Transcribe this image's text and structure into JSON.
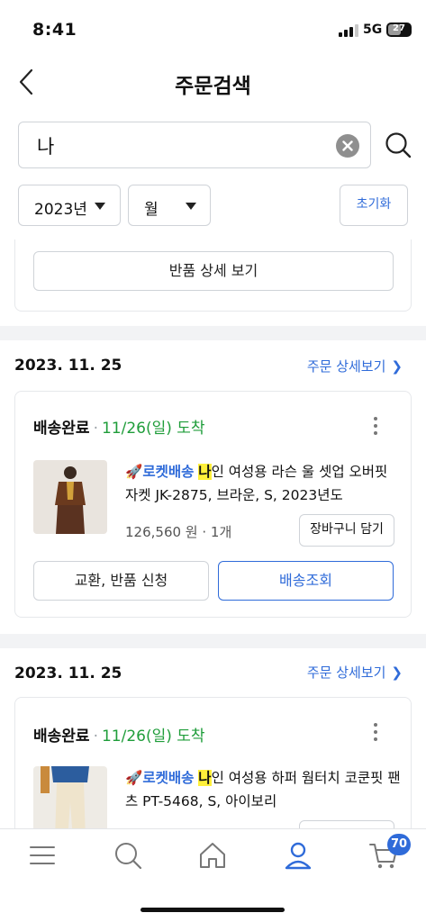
{
  "status_bar": {
    "time": "8:41",
    "network": "5G",
    "battery": "27"
  },
  "header": {
    "title": "주문검색"
  },
  "search": {
    "query": "나"
  },
  "filters": {
    "year": "2023년",
    "month": "월",
    "reset_label": "초기화"
  },
  "partial_order": {
    "return_detail_label": "반품 상세 보기"
  },
  "orders": [
    {
      "date": "2023. 11. 25",
      "detail_link": "주문 상세보기",
      "status": "배송완료",
      "arrival": "11/26(일) 도착",
      "rocket": "로켓배송",
      "highlight": "나",
      "name_rest": "인 여성용 라슨 울 셋업 오버핏 자켓 JK-2875, 브라운, S, 2023년도",
      "price": "126,560 원",
      "qty": "1개",
      "cart_label": "장바구니 담기",
      "exchange_label": "교환, 반품 신청",
      "track_label": "배송조회"
    },
    {
      "date": "2023. 11. 25",
      "detail_link": "주문 상세보기",
      "status": "배송완료",
      "arrival": "11/26(일) 도착",
      "rocket": "로켓배송",
      "highlight": "나",
      "name_rest": "인 여성용 하퍼 웜터치 코쿤핏 팬츠 PT-5468, S, 아이보리"
    }
  ],
  "bottom_nav": {
    "items": [
      "menu-icon",
      "search-icon",
      "home-icon",
      "my-account-icon",
      "cart-icon"
    ],
    "cart_badge": "70"
  },
  "colors": {
    "accent": "#2f6bd9",
    "arrival_green": "#1f9d3a",
    "highlight": "#fff03a",
    "border": "#cfd3d8"
  }
}
